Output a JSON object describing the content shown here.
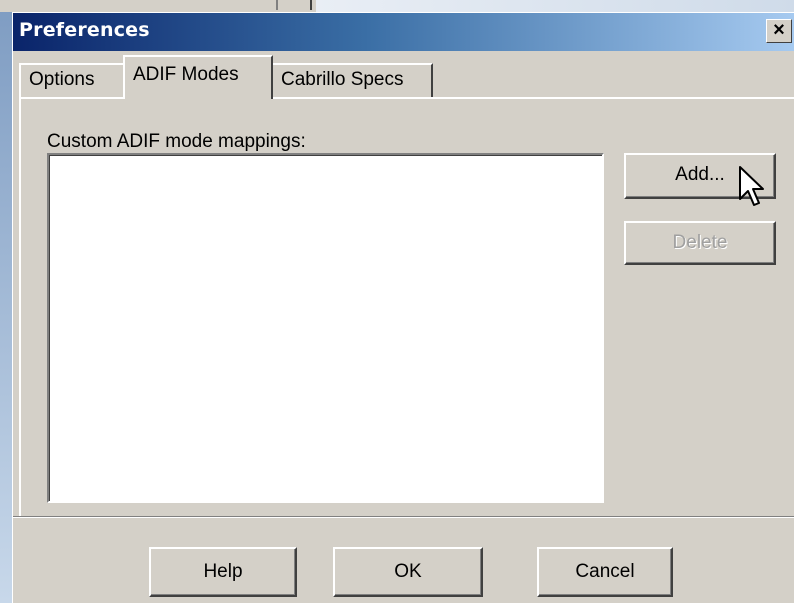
{
  "window": {
    "title": "Preferences",
    "close_label": "×"
  },
  "tabs": [
    {
      "label": "Options",
      "selected": false
    },
    {
      "label": "ADIF Modes",
      "selected": true
    },
    {
      "label": "Cabrillo Specs",
      "selected": false
    }
  ],
  "adif_modes": {
    "list_label": "Custom ADIF mode mappings:",
    "list_items": [],
    "add_label": "Add...",
    "delete_label": "Delete",
    "delete_enabled": false
  },
  "footer": {
    "help_label": "Help",
    "ok_label": "OK",
    "cancel_label": "Cancel"
  },
  "colors": {
    "titlebar_start": "#0a246a",
    "titlebar_end": "#a6caf0",
    "face": "#d4d0c8"
  },
  "icons": {
    "cursor": "arrow-cursor-icon"
  }
}
